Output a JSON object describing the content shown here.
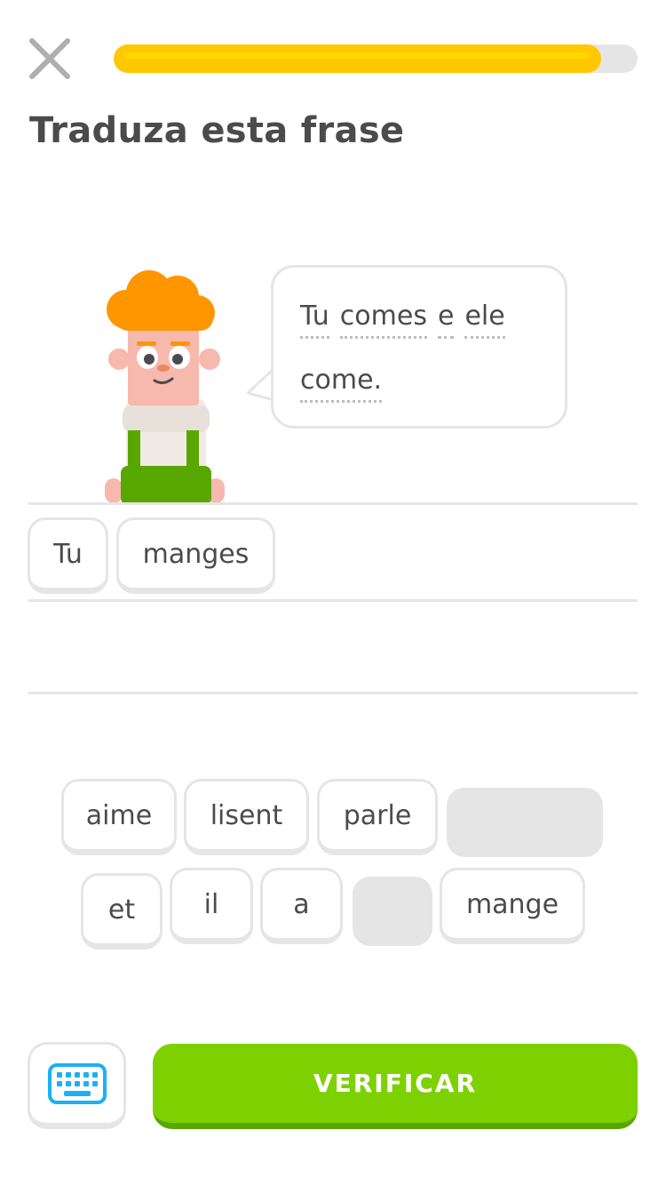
{
  "header": {
    "close_icon": "close-icon",
    "progress_fraction": 0.93
  },
  "prompt": {
    "title": "Traduza esta frase"
  },
  "bubble": {
    "line1": [
      "Tu",
      "comes",
      "e",
      "ele"
    ],
    "line2": [
      "come."
    ]
  },
  "answer": {
    "tiles": [
      "Tu",
      "manges"
    ]
  },
  "word_bank": {
    "row1": [
      "aime",
      "lisent",
      "parle"
    ],
    "row2": [
      "et",
      "il",
      "a",
      "mange"
    ]
  },
  "footer": {
    "keyboard_icon": "keyboard-icon",
    "verify_label": "VERIFICAR"
  },
  "colors": {
    "progress": "#ffc800",
    "verify": "#7ed100",
    "keyboard": "#1cb0f6",
    "hair": "#ff9600",
    "overalls": "#58a700"
  }
}
